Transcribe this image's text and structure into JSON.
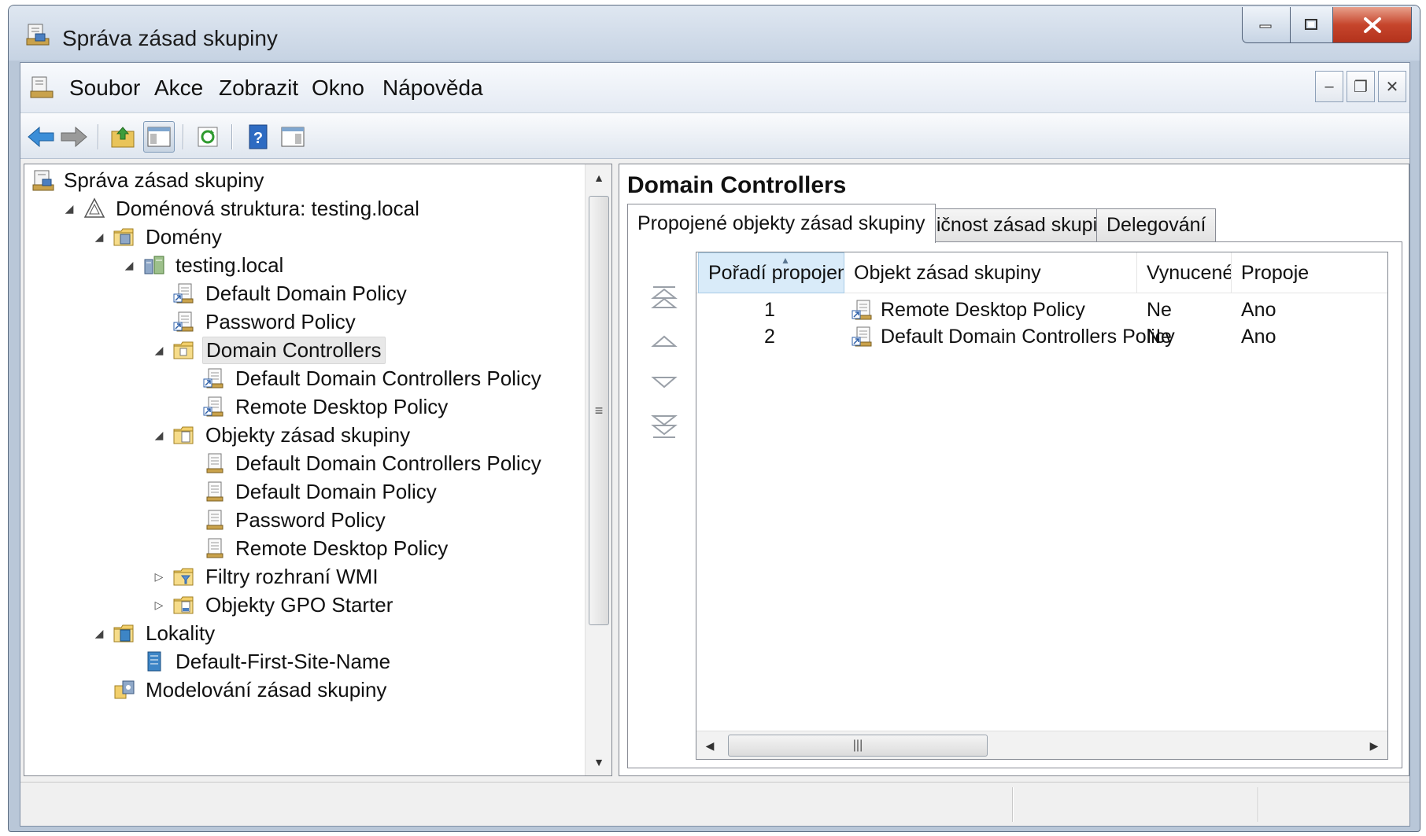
{
  "window": {
    "title": "Správa zásad skupiny"
  },
  "menu": {
    "items": [
      "Soubor",
      "Akce",
      "Zobrazit",
      "Okno",
      "Nápověda"
    ]
  },
  "toolbar": {
    "icons": [
      "back-arrow-icon",
      "forward-arrow-icon",
      "up-folder-icon",
      "show-hide-tree-icon",
      "refresh-icon",
      "help-icon",
      "action-pane-icon"
    ]
  },
  "tree": {
    "items": [
      {
        "label": "Správa zásad skupiny",
        "level": 0,
        "expander": "none",
        "icon": "gpmc-icon"
      },
      {
        "label": "Doménová struktura: testing.local",
        "level": 1,
        "expander": "expanded",
        "icon": "forest-icon"
      },
      {
        "label": "Domény",
        "level": 2,
        "expander": "expanded",
        "icon": "domains-folder-icon"
      },
      {
        "label": "testing.local",
        "level": 3,
        "expander": "expanded",
        "icon": "domain-icon"
      },
      {
        "label": "Default Domain Policy",
        "level": 4,
        "expander": "none",
        "icon": "gpo-link-icon"
      },
      {
        "label": "Password Policy",
        "level": 4,
        "expander": "none",
        "icon": "gpo-link-icon"
      },
      {
        "label": "Domain Controllers",
        "level": 4,
        "expander": "expanded",
        "icon": "ou-folder-icon",
        "selected": true
      },
      {
        "label": "Default Domain Controllers Policy",
        "level": 5,
        "expander": "none",
        "icon": "gpo-link-icon"
      },
      {
        "label": "Remote Desktop Policy",
        "level": 5,
        "expander": "none",
        "icon": "gpo-link-icon"
      },
      {
        "label": "Objekty zásad skupiny",
        "level": 4,
        "expander": "expanded",
        "icon": "gpo-folder-icon"
      },
      {
        "label": "Default Domain Controllers Policy",
        "level": 5,
        "expander": "none",
        "icon": "gpo-icon"
      },
      {
        "label": "Default Domain Policy",
        "level": 5,
        "expander": "none",
        "icon": "gpo-icon"
      },
      {
        "label": "Password Policy",
        "level": 5,
        "expander": "none",
        "icon": "gpo-icon"
      },
      {
        "label": "Remote Desktop Policy",
        "level": 5,
        "expander": "none",
        "icon": "gpo-icon"
      },
      {
        "label": "Filtry rozhraní WMI",
        "level": 4,
        "expander": "collapsed",
        "icon": "wmi-folder-icon"
      },
      {
        "label": "Objekty GPO Starter",
        "level": 4,
        "expander": "collapsed",
        "icon": "starter-gpo-folder-icon"
      },
      {
        "label": "Lokality",
        "level": 2,
        "expander": "expanded",
        "icon": "sites-folder-icon"
      },
      {
        "label": "Default-First-Site-Name",
        "level": 3,
        "expander": "none",
        "icon": "site-icon"
      },
      {
        "label": "Modelování zásad skupiny",
        "level": 2,
        "expander": "none",
        "icon": "modeling-icon"
      }
    ]
  },
  "details": {
    "title": "Domain Controllers",
    "tabs": [
      "Propojené objekty zásad skupiny",
      "Dědičnost zásad skupiny",
      "Delegování"
    ],
    "active_tab": 0,
    "columns": [
      "Pořadí propojení",
      "Objekt zásad skupiny",
      "Vynucené",
      "Propoje"
    ],
    "rows": [
      {
        "order": "1",
        "gpo": "Remote Desktop Policy",
        "enforced": "Ne",
        "link": "Ano"
      },
      {
        "order": "2",
        "gpo": "Default Domain Controllers Policy",
        "enforced": "Ne",
        "link": "Ano"
      }
    ],
    "order_buttons": [
      "move-to-top-icon",
      "move-up-icon",
      "move-down-icon",
      "move-to-bottom-icon"
    ]
  },
  "colors": {
    "accent": "#3c7fb1",
    "selection": "#e8e8e8",
    "sorted_header": "#d9ebf9",
    "close_button": "#c6452c"
  }
}
